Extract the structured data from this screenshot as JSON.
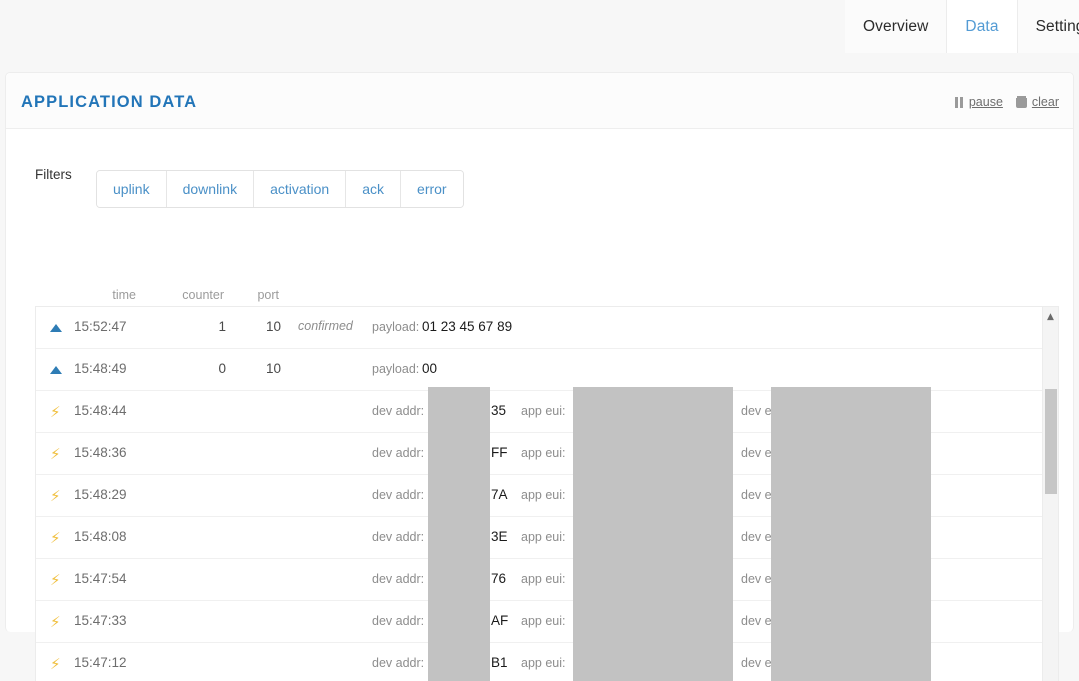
{
  "nav": {
    "tabs": [
      {
        "label": "Overview",
        "active": false
      },
      {
        "label": "Data",
        "active": true
      },
      {
        "label": "Settings",
        "active": false
      }
    ]
  },
  "panel": {
    "title": "APPLICATION DATA",
    "actions": {
      "pause": {
        "label": "pause",
        "icon": "pause-icon"
      },
      "clear": {
        "label": "clear",
        "icon": "trash-icon"
      }
    }
  },
  "filters": {
    "label": "Filters",
    "buttons": [
      {
        "label": "uplink"
      },
      {
        "label": "downlink"
      },
      {
        "label": "activation"
      },
      {
        "label": "ack"
      },
      {
        "label": "error"
      }
    ]
  },
  "table": {
    "columns": {
      "time": "time",
      "counter": "counter",
      "port": "port"
    },
    "labels": {
      "payload": "payload:",
      "dev_addr": "dev addr:",
      "app_eui": "app eui:",
      "dev_eui": "dev eui:",
      "confirmed": "confirmed"
    },
    "rows": [
      {
        "kind": "uplink",
        "icon": "uplink-triangle-icon",
        "time": "15:52:47",
        "counter": "1",
        "port": "10",
        "confirmed": "confirmed",
        "payload": "01 23 45 67 89"
      },
      {
        "kind": "uplink",
        "icon": "uplink-triangle-icon",
        "time": "15:48:49",
        "counter": "0",
        "port": "10",
        "confirmed": "",
        "payload": "00"
      },
      {
        "kind": "activation",
        "icon": "activation-bolt-icon",
        "time": "15:48:44",
        "dev_addr_suffix": "35"
      },
      {
        "kind": "activation",
        "icon": "activation-bolt-icon",
        "time": "15:48:36",
        "dev_addr_suffix": "FF"
      },
      {
        "kind": "activation",
        "icon": "activation-bolt-icon",
        "time": "15:48:29",
        "dev_addr_suffix": "7A"
      },
      {
        "kind": "activation",
        "icon": "activation-bolt-icon",
        "time": "15:48:08",
        "dev_addr_suffix": "3E"
      },
      {
        "kind": "activation",
        "icon": "activation-bolt-icon",
        "time": "15:47:54",
        "dev_addr_suffix": "76"
      },
      {
        "kind": "activation",
        "icon": "activation-bolt-icon",
        "time": "15:47:33",
        "dev_addr_suffix": "AF"
      },
      {
        "kind": "activation",
        "icon": "activation-bolt-icon",
        "time": "15:47:12",
        "dev_addr_suffix": "B1"
      }
    ],
    "scrollbar": {
      "up_arrow": "▲"
    }
  },
  "colors": {
    "accent_blue": "#2275b8",
    "link_blue": "#4a90c7",
    "active_tab": "#539bd4",
    "bolt_yellow": "#f0c040",
    "uplink_blue": "#2e7cb5",
    "redaction_gray": "#c2c2c2"
  }
}
